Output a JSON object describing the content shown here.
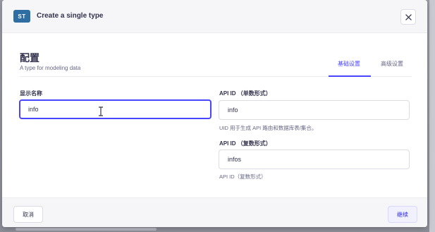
{
  "modal": {
    "badge": "ST",
    "title": "Create a single type",
    "close_icon": "close-icon"
  },
  "section": {
    "title": "配置",
    "subtitle": "A type for modeling data"
  },
  "tabs": [
    {
      "label": "基础设置",
      "active": true
    },
    {
      "label": "高级设置",
      "active": false
    }
  ],
  "fields": {
    "display_name": {
      "label": "显示名称",
      "value": "info"
    },
    "api_id_singular": {
      "label": "API ID （单数形式）",
      "value": "info",
      "hint": "UID 用于生成 API 路由和数据库表/集合。"
    },
    "api_id_plural": {
      "label": "API ID （复数形式）",
      "value": "infos",
      "hint": "API ID（复数形式）"
    }
  },
  "footer": {
    "cancel_label": "取消",
    "continue_label": "继续"
  },
  "colors": {
    "accent": "#4945ff",
    "badge": "#2f6ea3",
    "header_bg": "#f6f6f9"
  }
}
